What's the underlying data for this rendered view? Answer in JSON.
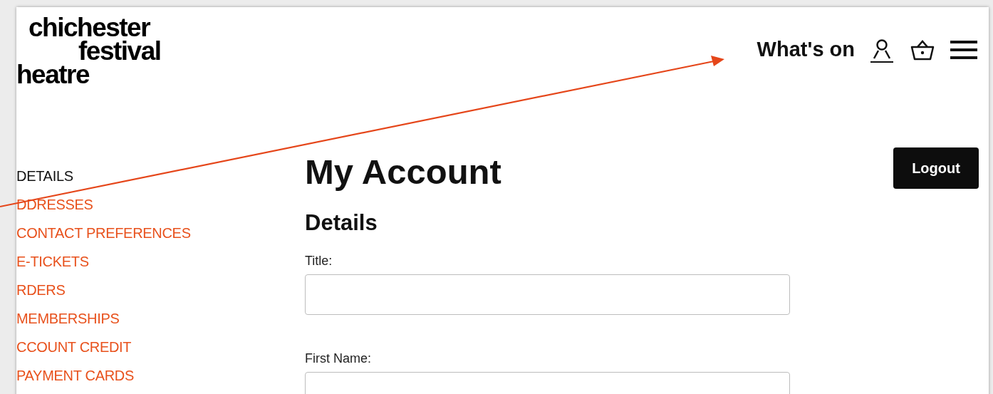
{
  "logo": {
    "lines": [
      "chichester",
      "festival",
      "heatre"
    ]
  },
  "nav": {
    "link": "What's on"
  },
  "sidebar": {
    "items": [
      {
        "label": "DETAILS",
        "selected": true
      },
      {
        "label": "DDRESSES",
        "selected": false
      },
      {
        "label": "CONTACT PREFERENCES",
        "selected": false
      },
      {
        "label": "E-TICKETS",
        "selected": false
      },
      {
        "label": "RDERS",
        "selected": false
      },
      {
        "label": "MEMBERSHIPS",
        "selected": false
      },
      {
        "label": "CCOUNT CREDIT",
        "selected": false
      },
      {
        "label": "PAYMENT CARDS",
        "selected": false
      }
    ]
  },
  "main": {
    "title": "My Account",
    "logout": "Logout",
    "section": "Details",
    "fields": [
      {
        "label": "Title:"
      },
      {
        "label": "First Name:"
      }
    ]
  }
}
